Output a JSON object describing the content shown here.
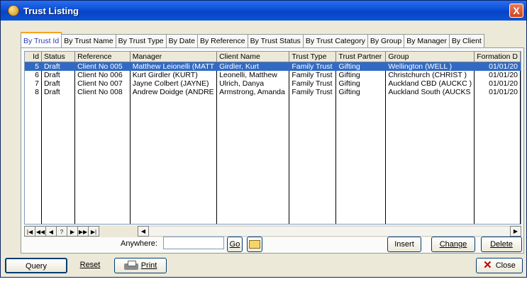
{
  "window": {
    "title": "Trust Listing",
    "close_glyph": "X"
  },
  "tabs": [
    {
      "label": "By Trust Id"
    },
    {
      "label": "By Trust Name"
    },
    {
      "label": "By Trust Type"
    },
    {
      "label": "By Date"
    },
    {
      "label": "By Reference"
    },
    {
      "label": "By Trust Status"
    },
    {
      "label": "By Trust Category"
    },
    {
      "label": "By Group"
    },
    {
      "label": "By Manager"
    },
    {
      "label": "By Client"
    }
  ],
  "grid": {
    "columns": [
      "Id",
      "Status",
      "Reference",
      "Manager",
      "Client Name",
      "Trust Type",
      "Trust Partner",
      "Group",
      "Formation D"
    ],
    "rows": [
      {
        "id": "5",
        "status": "Draft",
        "reference": "Client No 005",
        "manager": "Matthew Leionelli (MATT",
        "client": "Girdler, Kurt",
        "type": "Family Trust",
        "partner": "Gifting",
        "group": "Wellington (WELL )",
        "formation": "01/01/20"
      },
      {
        "id": "6",
        "status": "Draft",
        "reference": "Client No 006",
        "manager": "Kurt Girdler (KURT)",
        "client": "Leonelli, Matthew",
        "type": "Family Trust",
        "partner": "Gifting",
        "group": "Christchurch (CHRIST )",
        "formation": "01/01/20"
      },
      {
        "id": "7",
        "status": "Draft",
        "reference": "Client No 007",
        "manager": "Jayne Colbert (JAYNE)",
        "client": "Ulrich, Danya",
        "type": "Family Trust",
        "partner": "Gifting",
        "group": "Auckland CBD (AUCKC )",
        "formation": "01/01/20"
      },
      {
        "id": "8",
        "status": "Draft",
        "reference": "Client No 008",
        "manager": "Andrew Doidge (ANDRE",
        "client": "Armstrong, Amanda",
        "type": "Family Trust",
        "partner": "Gifting",
        "group": "Auckland South (AUCKS",
        "formation": "01/01/20"
      }
    ]
  },
  "navigator": {
    "first": "|◀",
    "prev_page": "◀◀",
    "prev": "◀",
    "find": "?",
    "next": "▶",
    "next_page": "▶▶",
    "last": "▶|"
  },
  "search": {
    "label": "Anywhere:",
    "value": "",
    "go_label": "Go"
  },
  "actions": {
    "insert": "Insert",
    "change": "Change",
    "delete": "Delete"
  },
  "footer": {
    "query": "Query",
    "reset": "Reset",
    "print": "Print",
    "close": "Close"
  }
}
